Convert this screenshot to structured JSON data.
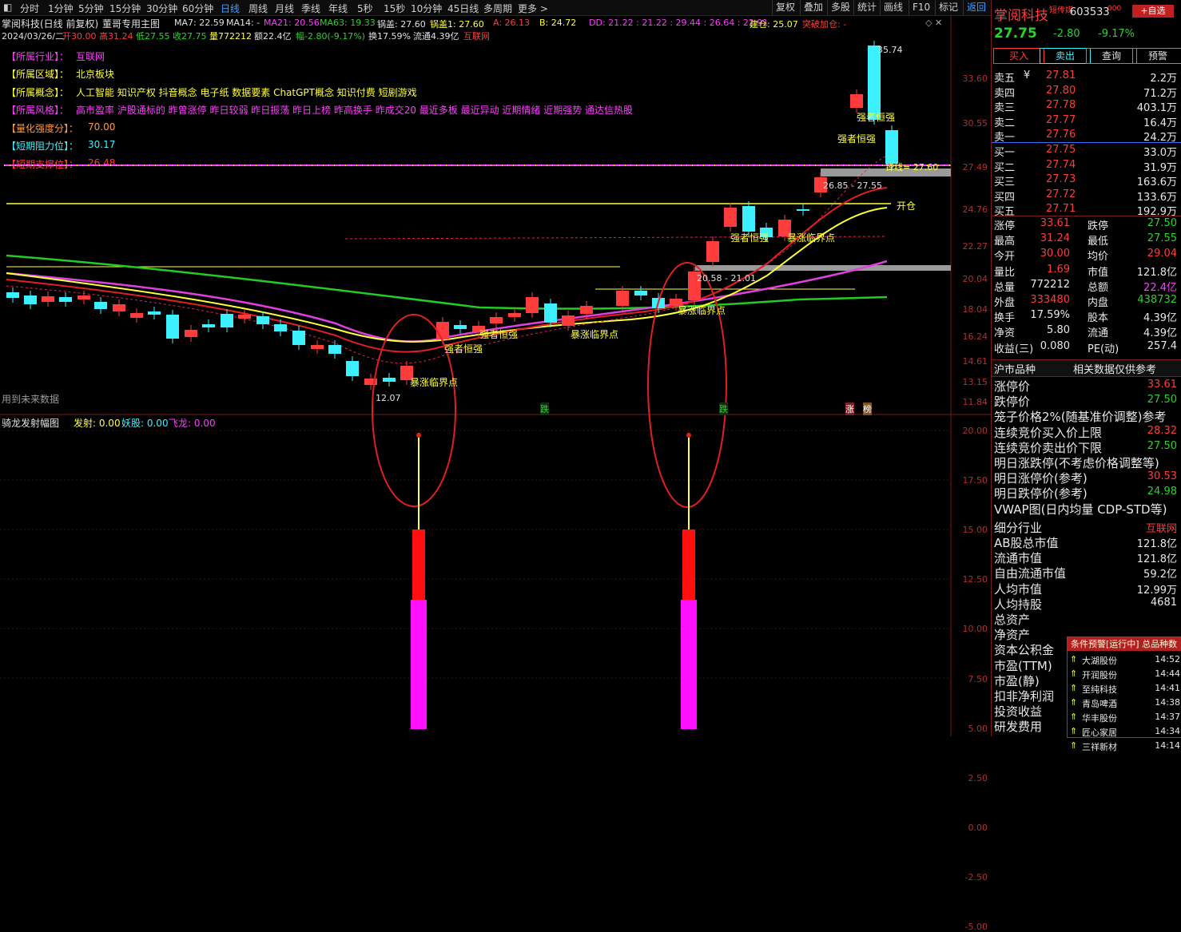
{
  "toolbar": {
    "periods": [
      "分时",
      "1分钟",
      "5分钟",
      "15分钟",
      "30分钟",
      "60分钟",
      "日线",
      "周线",
      "月线",
      "季线",
      "年线",
      "5秒",
      "15秒",
      "10分钟",
      "45日线",
      "多周期",
      "更多 >"
    ],
    "active": "日线",
    "right_buttons": [
      "复权",
      "叠加",
      "多股",
      "统计",
      "画线",
      "F10",
      "标记",
      "返回"
    ]
  },
  "chart_header": {
    "stock": "掌阅科技(日线 前复权)",
    "indicator": "董哥专用主图",
    "ma7": "MA7: 22.59",
    "ma14": "MA14: -",
    "ma21": "MA21: 20.56",
    "ma63": "MA63: 19.33",
    "guogai": "锅盖: 27.60",
    "guogai1": "锅盖1: 27.60",
    "a": "A: 26.13",
    "b": "B: 24.72",
    "dd": "DD: 21.22 : 21.22 : 29.44 : 26.64 : 22.91",
    "jiancang": "建仓: 25.07",
    "tupo": "突破加仓: -"
  },
  "info_line": {
    "date": "2024/03/26/二",
    "open": "开30.00",
    "high": "高31.24",
    "low": "低27.55",
    "close": "收27.75",
    "vol": "量772212",
    "amount": "额22.4亿",
    "change": "幅-2.80(-9.17%)",
    "turnover": "换17.59%",
    "float": "流通4.39亿",
    "sector": "互联网"
  },
  "annotations": {
    "industry_label": "【所属行业】：",
    "industry": "互联网",
    "region_label": "【所属区域】：",
    "region": "北京板块",
    "concept_label": "【所属概念】：",
    "concept": "人工智能 知识产权 抖音概念 电子纸 数据要素 ChatGPT概念 知识付费 短剧游戏",
    "style_label": "【所属风格】：",
    "style": "高市盈率 沪股通标的 昨曾涨停 昨日较弱 昨日振荡 昨日上榜 昨高换手 昨成交20 最近多板 最近异动 近期情绪 近期强势 通达信热股",
    "strength_label": "【量化强度分】：",
    "strength": "70.00",
    "resist_label": "【短期阻力位】：",
    "resist": "30.17",
    "support_label": "【短期支撑位】：",
    "support": "26.48"
  },
  "main_axis": [
    "33.60",
    "30.55",
    "27.49",
    "24.76",
    "22.27",
    "20.04",
    "18.04",
    "16.24",
    "14.61",
    "13.15",
    "11.84"
  ],
  "chart_labels": {
    "high_price": "35.74",
    "low_price": "12.07",
    "strong1": "强者恒强",
    "strong2": "强者恒强",
    "strong3": "强者恒强",
    "strong4": "强者恒强",
    "strong5": "强者恒强",
    "burst1": "暴涨临界点",
    "burst2": "暴涨临界点",
    "burst3": "暴涨临界点",
    "burst4": "暴涨临界点",
    "fengxian": "锋线= 27.60",
    "range1": "26.85 - 27.55",
    "range2": "20.58 - 21.01",
    "kaicang": "开仓",
    "future": "用到未来数据",
    "die1": "跌",
    "die2": "跌",
    "zhang": "涨",
    "bang": "榜"
  },
  "sub_header": {
    "name": "骑龙发射幅图",
    "fashe": "发射: 0.00",
    "yaogu": "妖股: 0.00",
    "feilong": "飞龙: 0.00"
  },
  "sub_axis": [
    "20.00",
    "17.50",
    "15.00",
    "12.50",
    "10.00",
    "7.50",
    "5.00",
    "2.50",
    "0.00",
    "-2.50",
    "-5.00"
  ],
  "quote": {
    "name": "掌阅科技",
    "tag": "短传媒",
    "code": "603533",
    "code_sup": "000",
    "add_btn": "+自选",
    "price": "27.75",
    "change": "-2.80",
    "pct": "-9.17%",
    "buttons": [
      "买入",
      "卖出",
      "查询",
      "预警"
    ],
    "asks": [
      {
        "label": "卖五",
        "price": "27.81",
        "vol": "2.2万",
        "mark": "¥"
      },
      {
        "label": "卖四",
        "price": "27.80",
        "vol": "71.2万"
      },
      {
        "label": "卖三",
        "price": "27.78",
        "vol": "403.1万"
      },
      {
        "label": "卖二",
        "price": "27.77",
        "vol": "16.4万"
      },
      {
        "label": "卖一",
        "price": "27.76",
        "vol": "24.2万"
      }
    ],
    "bids": [
      {
        "label": "买一",
        "price": "27.75",
        "vol": "33.0万"
      },
      {
        "label": "买二",
        "price": "27.74",
        "vol": "31.9万"
      },
      {
        "label": "买三",
        "price": "27.73",
        "vol": "163.6万"
      },
      {
        "label": "买四",
        "price": "27.72",
        "vol": "133.6万"
      },
      {
        "label": "买五",
        "price": "27.71",
        "vol": "192.9万"
      }
    ],
    "stats": [
      {
        "l1": "涨停",
        "v1": "33.61",
        "c1": "red",
        "l2": "跌停",
        "v2": "27.50",
        "c2": "green"
      },
      {
        "l1": "最高",
        "v1": "31.24",
        "c1": "red",
        "l2": "最低",
        "v2": "27.55",
        "c2": "green"
      },
      {
        "l1": "今开",
        "v1": "30.00",
        "c1": "red",
        "l2": "均价",
        "v2": "29.04",
        "c2": "red"
      },
      {
        "l1": "量比",
        "v1": "1.69",
        "c1": "red",
        "l2": "市值",
        "v2": "121.8亿",
        "c2": "white"
      },
      {
        "l1": "总量",
        "v1": "772212",
        "c1": "white",
        "l2": "总额",
        "v2": "22.4亿",
        "c2": "magenta"
      },
      {
        "l1": "外盘",
        "v1": "333480",
        "c1": "red",
        "l2": "内盘",
        "v2": "438732",
        "c2": "green"
      },
      {
        "l1": "换手",
        "v1": "17.59%",
        "c1": "white",
        "l2": "股本",
        "v2": "4.39亿",
        "c2": "white"
      },
      {
        "l1": "净资",
        "v1": "5.80",
        "c1": "white",
        "l2": "流通",
        "v2": "4.39亿",
        "c2": "white"
      },
      {
        "l1": "收益(三)",
        "v1": "0.080",
        "c1": "white",
        "l2": "PE(动)",
        "v2": "257.4",
        "c2": "white"
      }
    ],
    "tab1": "沪市品种",
    "tab2": "相关数据仅供参考",
    "limit_rows": [
      {
        "l": "涨停价",
        "v": "33.61",
        "c": "red"
      },
      {
        "l": "跌停价",
        "v": "27.50",
        "c": "green"
      }
    ],
    "cage_title": "笼子价格2%(随基准价调整)参考",
    "auction_rows": [
      {
        "l": "连续竞价买入价上限",
        "v": "28.32",
        "c": "red"
      },
      {
        "l": "连续竞价卖出价下限",
        "v": "27.50",
        "c": "green"
      }
    ],
    "tomorrow_title": "明日涨跌停(不考虑价格调整等)",
    "tomorrow_rows": [
      {
        "l": "明日涨停价(参考)",
        "v": "30.53",
        "c": "red"
      },
      {
        "l": "明日跌停价(参考)",
        "v": "24.98",
        "c": "green"
      }
    ],
    "vwap": "VWAP图(日内均量 CDP-STD等)",
    "detail_rows": [
      {
        "l": "细分行业",
        "v": "互联网",
        "c": "red"
      },
      {
        "l": "AB股总市值",
        "v": "121.8亿",
        "c": "white"
      },
      {
        "l": "流通市值",
        "v": "121.8亿",
        "c": "white"
      },
      {
        "l": "自由流通市值",
        "v": "59.2亿",
        "c": "white"
      },
      {
        "l": "人均市值",
        "v": "12.99万",
        "c": "white"
      },
      {
        "l": "人均持股",
        "v": "4681",
        "c": "white"
      },
      {
        "l": "总资产",
        "v": "",
        "c": "white"
      },
      {
        "l": "净资产",
        "v": "",
        "c": "white"
      },
      {
        "l": "资本公积金",
        "v": "",
        "c": "white"
      },
      {
        "l": "市盈(TTM)",
        "v": "",
        "c": "white"
      },
      {
        "l": "市盈(静)",
        "v": "",
        "c": "white"
      },
      {
        "l": "扣非净利润",
        "v": "",
        "c": "white"
      },
      {
        "l": "投资收益",
        "v": "",
        "c": "white"
      },
      {
        "l": "研发费用",
        "v": "",
        "c": "white"
      }
    ]
  },
  "alerts": {
    "header": "条件预警[运行中] 总品种数",
    "items": [
      {
        "name": "大湖股份",
        "time": "14:52"
      },
      {
        "name": "开润股份",
        "time": "14:44"
      },
      {
        "name": "至纯科技",
        "time": "14:41"
      },
      {
        "name": "青岛啤酒",
        "time": "14:38"
      },
      {
        "name": "华丰股份",
        "time": "14:37"
      },
      {
        "name": "匠心家居",
        "time": "14:34"
      },
      {
        "name": "三祥新材",
        "time": "14:14"
      }
    ]
  },
  "colors": {
    "up": "#ff3c3c",
    "down": "#3cf0ff",
    "ma_yellow": "#ffff3c",
    "ma_red": "#e02020",
    "ma_magenta": "#e040e0",
    "ma_green": "#22cc22"
  }
}
